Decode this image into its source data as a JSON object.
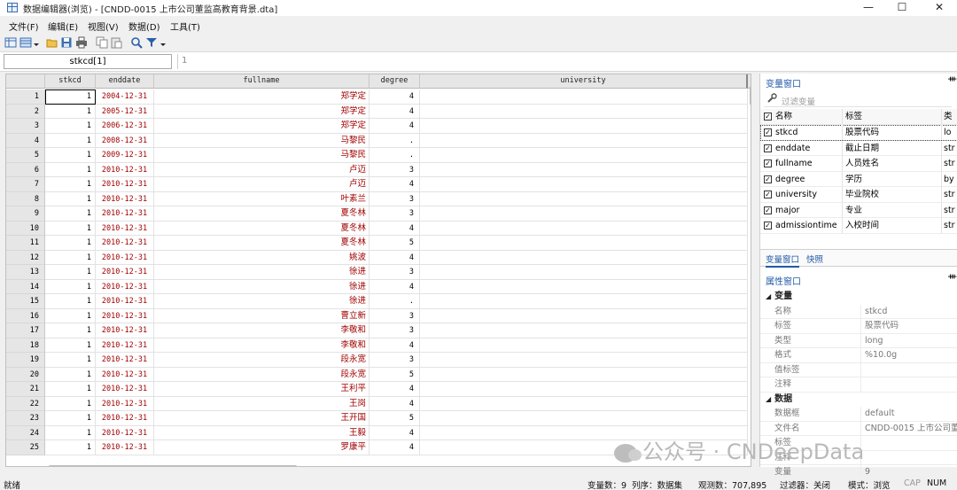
{
  "window": {
    "title": "数据编辑器(浏览) - [CNDD-0015 上市公司董监高教育背景.dta]",
    "minimize": "—",
    "maximize": "☐",
    "close": "✕"
  },
  "menu": [
    "文件(F)",
    "编辑(E)",
    "视图(V)",
    "数据(D)",
    "工具(T)"
  ],
  "toolbar_icons": [
    "data-editor-icon",
    "browse-icon",
    "dropdown-icon",
    "open-folder-icon",
    "save-icon",
    "print-icon",
    "copy-icon",
    "paste-icon",
    "search-icon",
    "filter-icon",
    "dropdown-icon"
  ],
  "cellbar": {
    "name": "stkcd[1]",
    "value": "1"
  },
  "grid": {
    "columns": [
      "stkcd",
      "enddate",
      "fullname",
      "degree",
      "university"
    ],
    "rows": [
      {
        "n": "1",
        "stkcd": "1",
        "enddate": "2004-12-31",
        "fullname": "郑学定",
        "degree": "4"
      },
      {
        "n": "2",
        "stkcd": "1",
        "enddate": "2005-12-31",
        "fullname": "郑学定",
        "degree": "4"
      },
      {
        "n": "3",
        "stkcd": "1",
        "enddate": "2006-12-31",
        "fullname": "郑学定",
        "degree": "4"
      },
      {
        "n": "4",
        "stkcd": "1",
        "enddate": "2008-12-31",
        "fullname": "马黎民",
        "degree": "."
      },
      {
        "n": "5",
        "stkcd": "1",
        "enddate": "2009-12-31",
        "fullname": "马黎民",
        "degree": "."
      },
      {
        "n": "6",
        "stkcd": "1",
        "enddate": "2010-12-31",
        "fullname": "卢迈",
        "degree": "3"
      },
      {
        "n": "7",
        "stkcd": "1",
        "enddate": "2010-12-31",
        "fullname": "卢迈",
        "degree": "4"
      },
      {
        "n": "8",
        "stkcd": "1",
        "enddate": "2010-12-31",
        "fullname": "叶素兰",
        "degree": "3"
      },
      {
        "n": "9",
        "stkcd": "1",
        "enddate": "2010-12-31",
        "fullname": "夏冬林",
        "degree": "3"
      },
      {
        "n": "10",
        "stkcd": "1",
        "enddate": "2010-12-31",
        "fullname": "夏冬林",
        "degree": "4"
      },
      {
        "n": "11",
        "stkcd": "1",
        "enddate": "2010-12-31",
        "fullname": "夏冬林",
        "degree": "5"
      },
      {
        "n": "12",
        "stkcd": "1",
        "enddate": "2010-12-31",
        "fullname": "姚波",
        "degree": "4"
      },
      {
        "n": "13",
        "stkcd": "1",
        "enddate": "2010-12-31",
        "fullname": "徐进",
        "degree": "3"
      },
      {
        "n": "14",
        "stkcd": "1",
        "enddate": "2010-12-31",
        "fullname": "徐进",
        "degree": "4"
      },
      {
        "n": "15",
        "stkcd": "1",
        "enddate": "2010-12-31",
        "fullname": "徐进",
        "degree": "."
      },
      {
        "n": "16",
        "stkcd": "1",
        "enddate": "2010-12-31",
        "fullname": "曹立新",
        "degree": "3"
      },
      {
        "n": "17",
        "stkcd": "1",
        "enddate": "2010-12-31",
        "fullname": "李敬和",
        "degree": "3"
      },
      {
        "n": "18",
        "stkcd": "1",
        "enddate": "2010-12-31",
        "fullname": "李敬和",
        "degree": "4"
      },
      {
        "n": "19",
        "stkcd": "1",
        "enddate": "2010-12-31",
        "fullname": "段永宽",
        "degree": "3"
      },
      {
        "n": "20",
        "stkcd": "1",
        "enddate": "2010-12-31",
        "fullname": "段永宽",
        "degree": "5"
      },
      {
        "n": "21",
        "stkcd": "1",
        "enddate": "2010-12-31",
        "fullname": "王利平",
        "degree": "4"
      },
      {
        "n": "22",
        "stkcd": "1",
        "enddate": "2010-12-31",
        "fullname": "王岗",
        "degree": "4"
      },
      {
        "n": "23",
        "stkcd": "1",
        "enddate": "2010-12-31",
        "fullname": "王开国",
        "degree": "5"
      },
      {
        "n": "24",
        "stkcd": "1",
        "enddate": "2010-12-31",
        "fullname": "王毅",
        "degree": "4"
      },
      {
        "n": "25",
        "stkcd": "1",
        "enddate": "2010-12-31",
        "fullname": "罗康平",
        "degree": "4"
      }
    ]
  },
  "varpane": {
    "title": "变量窗口",
    "pin": "ᚒ",
    "filter_placeholder": "过滤变量",
    "headers": {
      "name": "名称",
      "label": "标签",
      "type": "类"
    },
    "vars": [
      {
        "name": "stkcd",
        "label": "股票代码",
        "type": "lo"
      },
      {
        "name": "enddate",
        "label": "截止日期",
        "type": "str"
      },
      {
        "name": "fullname",
        "label": "人员姓名",
        "type": "str"
      },
      {
        "name": "degree",
        "label": "学历",
        "type": "by"
      },
      {
        "name": "university",
        "label": "毕业院校",
        "type": "str"
      },
      {
        "name": "major",
        "label": "专业",
        "type": "str"
      },
      {
        "name": "admissiontime",
        "label": "入校时间",
        "type": "str"
      }
    ],
    "tabs": [
      "变量窗口",
      "快照"
    ]
  },
  "proppane": {
    "title": "属性窗口",
    "sections": [
      {
        "name": "变量",
        "rows": [
          {
            "k": "名称",
            "v": "stkcd"
          },
          {
            "k": "标签",
            "v": "股票代码"
          },
          {
            "k": "类型",
            "v": "long"
          },
          {
            "k": "格式",
            "v": "%10.0g"
          },
          {
            "k": "值标签",
            "v": ""
          },
          {
            "k": "注释",
            "v": ""
          }
        ]
      },
      {
        "name": "数据",
        "rows": [
          {
            "k": "数据框",
            "v": "default"
          },
          {
            "k": "文件名",
            "v": "CNDD-0015 上市公司董"
          },
          {
            "k": "标签",
            "v": ""
          },
          {
            "k": "注释",
            "v": ""
          },
          {
            "k": "变量",
            "v": "9"
          }
        ]
      }
    ]
  },
  "watermark": "公众号 · CNDeepData",
  "status": {
    "ready": "就绪",
    "vars": "变量数：9",
    "order": "列序：数据集",
    "obs": "观测数：707,895",
    "filter": "过滤器：关闭",
    "mode": "模式：浏览",
    "cap": "CAP",
    "num": "NUM"
  },
  "colors": {
    "string_text": "#a10000",
    "accent": "#1f5aa6"
  }
}
